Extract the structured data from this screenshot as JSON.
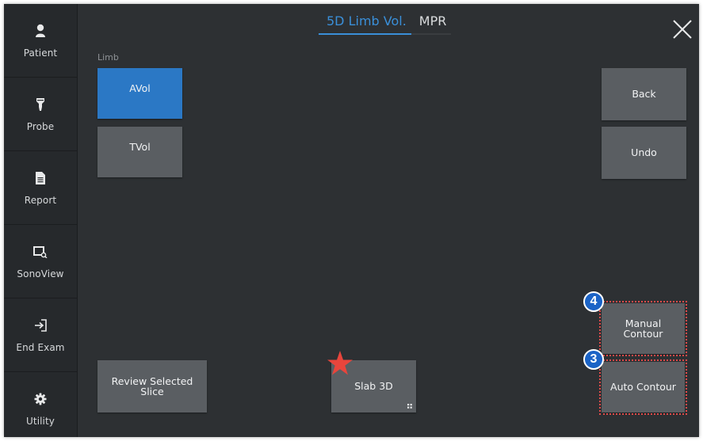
{
  "sidebar": {
    "items": [
      {
        "label": "Patient",
        "icon": "patient-icon"
      },
      {
        "label": "Probe",
        "icon": "probe-icon"
      },
      {
        "label": "Report",
        "icon": "report-icon"
      },
      {
        "label": "SonoView",
        "icon": "sonoview-icon"
      },
      {
        "label": "End Exam",
        "icon": "end-exam-icon"
      },
      {
        "label": "Utility",
        "icon": "gear-icon"
      }
    ]
  },
  "header": {
    "tabs": [
      {
        "label": "5D Limb Vol.",
        "active": true
      },
      {
        "label": "MPR",
        "active": false
      }
    ],
    "close_icon": "close-icon"
  },
  "main": {
    "section_label": "Limb",
    "buttons": {
      "avol": "AVol",
      "tvol": "TVol",
      "back": "Back",
      "undo": "Undo",
      "manual_contour": "Manual\nContour",
      "auto_contour": "Auto Contour",
      "review_selected_slice": "Review Selected\nSlice",
      "slab_3d": "Slab 3D"
    }
  },
  "annotations": {
    "badge_manual": "4",
    "badge_auto": "3",
    "star_icon": "star-icon",
    "highlight_color": "#e04a4a",
    "badge_color": "#1b63c6"
  },
  "colors": {
    "accent": "#3a8fd9",
    "selected_button": "#2b78c5",
    "button": "#5a5e62",
    "background": "#2d3033"
  }
}
